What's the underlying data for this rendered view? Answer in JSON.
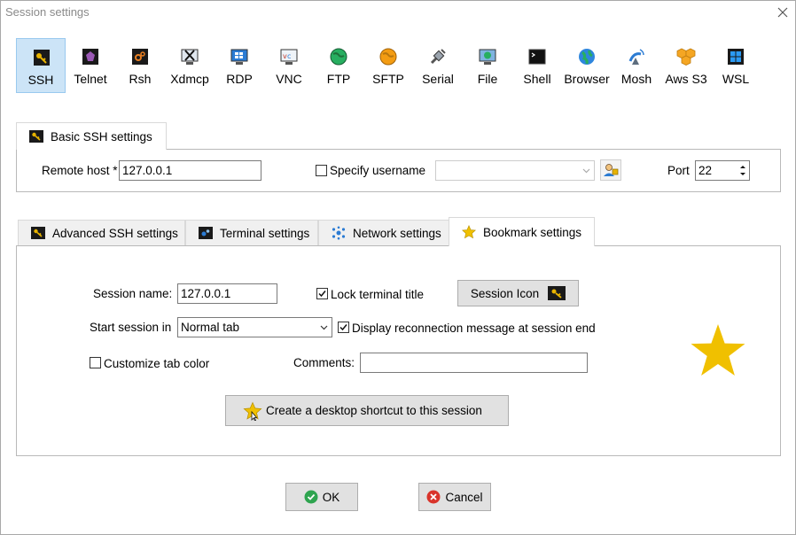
{
  "window": {
    "title": "Session settings"
  },
  "protocols": [
    {
      "label": "SSH",
      "icon": "ssh-icon",
      "selected": true
    },
    {
      "label": "Telnet",
      "icon": "telnet-icon"
    },
    {
      "label": "Rsh",
      "icon": "rsh-icon"
    },
    {
      "label": "Xdmcp",
      "icon": "xdmcp-icon"
    },
    {
      "label": "RDP",
      "icon": "rdp-icon"
    },
    {
      "label": "VNC",
      "icon": "vnc-icon"
    },
    {
      "label": "FTP",
      "icon": "ftp-icon"
    },
    {
      "label": "SFTP",
      "icon": "sftp-icon"
    },
    {
      "label": "Serial",
      "icon": "serial-icon"
    },
    {
      "label": "File",
      "icon": "file-icon"
    },
    {
      "label": "Shell",
      "icon": "shell-icon"
    },
    {
      "label": "Browser",
      "icon": "browser-icon"
    },
    {
      "label": "Mosh",
      "icon": "mosh-icon"
    },
    {
      "label": "Aws S3",
      "icon": "aws-s3-icon"
    },
    {
      "label": "WSL",
      "icon": "wsl-icon"
    }
  ],
  "basic": {
    "tab_label": "Basic SSH settings",
    "remote_host_label": "Remote host *",
    "remote_host_value": "127.0.0.1",
    "specify_username_label": "Specify username",
    "specify_username_checked": false,
    "username_value": "",
    "port_label": "Port",
    "port_value": "22"
  },
  "tabs": [
    {
      "label": "Advanced SSH settings",
      "icon": "key-icon"
    },
    {
      "label": "Terminal settings",
      "icon": "terminal-icon"
    },
    {
      "label": "Network settings",
      "icon": "network-icon"
    },
    {
      "label": "Bookmark settings",
      "icon": "star-icon",
      "active": true
    }
  ],
  "bookmark": {
    "session_name_label": "Session name:",
    "session_name_value": "127.0.0.1",
    "lock_terminal_title_label": "Lock terminal title",
    "lock_terminal_title_checked": true,
    "session_icon_label": "Session Icon",
    "start_session_label": "Start session in",
    "start_session_value": "Normal tab",
    "display_reconnect_label": "Display reconnection message at session end",
    "display_reconnect_checked": true,
    "customize_tab_color_label": "Customize tab color",
    "customize_tab_color_checked": false,
    "comments_label": "Comments:",
    "comments_value": "",
    "shortcut_label": "Create a desktop shortcut to this session"
  },
  "footer": {
    "ok_label": "OK",
    "cancel_label": "Cancel"
  },
  "colors": {
    "selected_bg": "#cce4f7",
    "star": "#f0c000",
    "ok_green": "#2ea44f",
    "cancel_red": "#d9342b"
  }
}
